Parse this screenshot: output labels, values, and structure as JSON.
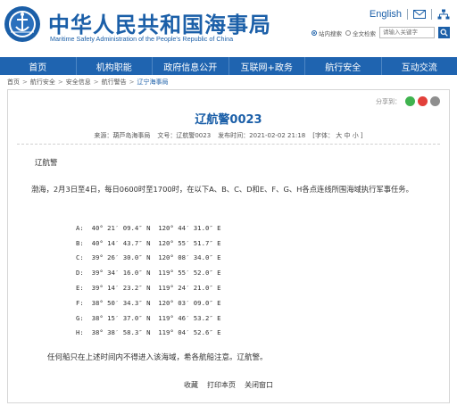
{
  "header": {
    "title": "中华人民共和国海事局",
    "subtitle": "Maritime Safety Administration of the People's Republic of China",
    "lang_link": "English",
    "search": {
      "options": [
        "站内搜索",
        "全文检索"
      ],
      "placeholder": "请输入关键字"
    }
  },
  "nav": {
    "items": [
      "首页",
      "机构职能",
      "政府信息公开",
      "互联网+政务",
      "航行安全",
      "互动交流"
    ]
  },
  "breadcrumb": [
    "首页",
    "航行安全",
    "安全信息",
    "航行警告",
    "辽宁海事局"
  ],
  "article": {
    "share_label": "分享到：",
    "title": "辽航警0023",
    "meta": {
      "source": "来源：葫芦岛海事局",
      "doc_no": "文号：辽航警0023",
      "publish_time": "发布时间：2021-02-02 21:18",
      "font_label": "[字体：",
      "font_large": "大",
      "font_medium": "中",
      "font_small": "小",
      "font_close": "]"
    },
    "heading": "辽航警",
    "paragraph": "渤海，2月3日至4日，每日0600时至1700时，在以下A、B、C、D和E、F、G、H各点连线所围海域执行军事任务。",
    "coordinates": [
      "A:  40° 21′ 09.4″ N  120° 44′ 31.0″ E",
      "B:  40° 14′ 43.7″ N  120° 55′ 51.7″ E",
      "C:  39° 26′ 30.0″ N  120° 08′ 34.0″ E",
      "D:  39° 34′ 16.0″ N  119° 55′ 52.0″ E",
      "E:  39° 14′ 23.2″ N  119° 24′ 21.0″ E",
      "F:  38° 50′ 34.3″ N  120° 03′ 09.0″ E",
      "G:  38° 15′ 37.0″ N  119° 46′ 53.2″ E",
      "H:  38° 38′ 58.3″ N  119° 04′ 52.6″ E"
    ],
    "closing": "任何船只在上述时间内不得进入该海域，希各航船注意。辽航警。",
    "footer": {
      "favorite": "收藏",
      "print": "打印本页",
      "close": "关闭窗口"
    }
  },
  "colors": {
    "brand_blue": "#1b5fa8",
    "nav_blue": "#1f64b0"
  }
}
